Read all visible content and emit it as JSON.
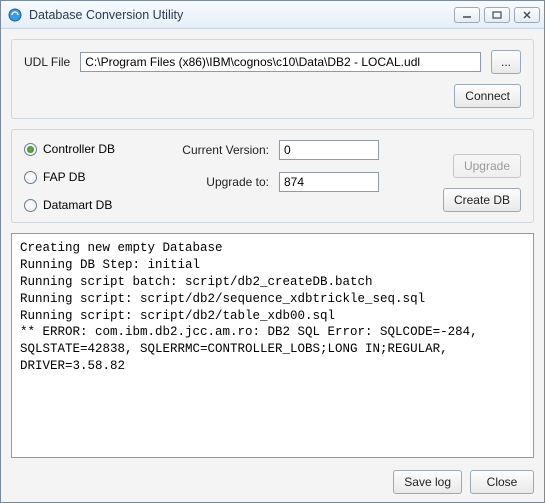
{
  "titlebar": {
    "title": "Database Conversion Utility"
  },
  "udl": {
    "label": "UDL File",
    "path_value": "C:\\Program Files (x86)\\IBM\\cognos\\c10\\Data\\DB2 - LOCAL.udl",
    "browse_label": "...",
    "connect_label": "Connect"
  },
  "db_panel": {
    "radios": {
      "controller": "Controller DB",
      "fap": "FAP DB",
      "datamart": "Datamart DB",
      "selected": "controller"
    },
    "current_version_label": "Current Version:",
    "current_version_value": "0",
    "upgrade_to_label": "Upgrade to:",
    "upgrade_to_value": "874",
    "upgrade_btn": "Upgrade",
    "create_db_btn": "Create DB"
  },
  "log_text": "Creating new empty Database\nRunning DB Step: initial\nRunning script batch: script/db2_createDB.batch\nRunning script: script/db2/sequence_xdbtrickle_seq.sql\nRunning script: script/db2/table_xdb00.sql\n** ERROR: com.ibm.db2.jcc.am.ro: DB2 SQL Error: SQLCODE=-284, SQLSTATE=42838, SQLERRMC=CONTROLLER_LOBS;LONG IN;REGULAR, DRIVER=3.58.82",
  "bottom": {
    "save_log": "Save log",
    "close": "Close"
  }
}
